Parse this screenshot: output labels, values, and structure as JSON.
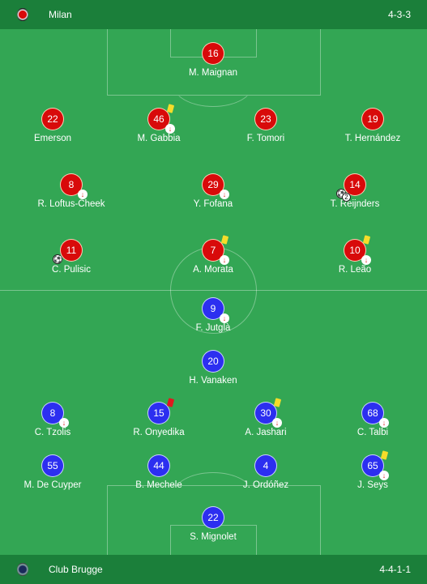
{
  "home": {
    "name": "Milan",
    "formation": "4-3-3",
    "crest_icon": "ac-milan-crest-icon",
    "color": "#d80a0a",
    "players": [
      {
        "num": "16",
        "name": "M. Maignan"
      },
      {
        "num": "22",
        "name": "Emerson"
      },
      {
        "num": "46",
        "name": "M. Gabbia",
        "yellow": true,
        "sub_off": true
      },
      {
        "num": "23",
        "name": "F. Tomori"
      },
      {
        "num": "19",
        "name": "T. Hernández"
      },
      {
        "num": "8",
        "name": "R. Loftus-Cheek",
        "sub_off": true
      },
      {
        "num": "29",
        "name": "Y. Fofana",
        "sub_off": true
      },
      {
        "num": "14",
        "name": "T. Reijnders",
        "goals": 2
      },
      {
        "num": "11",
        "name": "C. Pulisic",
        "goals": 1
      },
      {
        "num": "7",
        "name": "A. Morata",
        "yellow": true,
        "sub_off": true
      },
      {
        "num": "10",
        "name": "R. Leão",
        "yellow": true,
        "sub_off": true
      }
    ]
  },
  "away": {
    "name": "Club Brugge",
    "formation": "4-4-1-1",
    "crest_icon": "club-brugge-crest-icon",
    "color": "#2c2ff0",
    "players": [
      {
        "num": "9",
        "name": "F. Jutglà",
        "sub_off": true
      },
      {
        "num": "20",
        "name": "H. Vanaken"
      },
      {
        "num": "8",
        "name": "C. Tzolis",
        "sub_off": true
      },
      {
        "num": "15",
        "name": "R. Onyedika",
        "red": true
      },
      {
        "num": "30",
        "name": "A. Jashari",
        "yellow": true,
        "sub_off": true
      },
      {
        "num": "68",
        "name": "C. Talbi",
        "sub_off": true
      },
      {
        "num": "55",
        "name": "M. De Cuyper"
      },
      {
        "num": "44",
        "name": "B. Mechele"
      },
      {
        "num": "4",
        "name": "J. Ordóñez"
      },
      {
        "num": "65",
        "name": "J. Seys",
        "yellow": true,
        "sub_off": true
      },
      {
        "num": "22",
        "name": "S. Mignolet"
      }
    ]
  },
  "icons": {
    "sub_off": "↓",
    "goal": "⚽"
  }
}
